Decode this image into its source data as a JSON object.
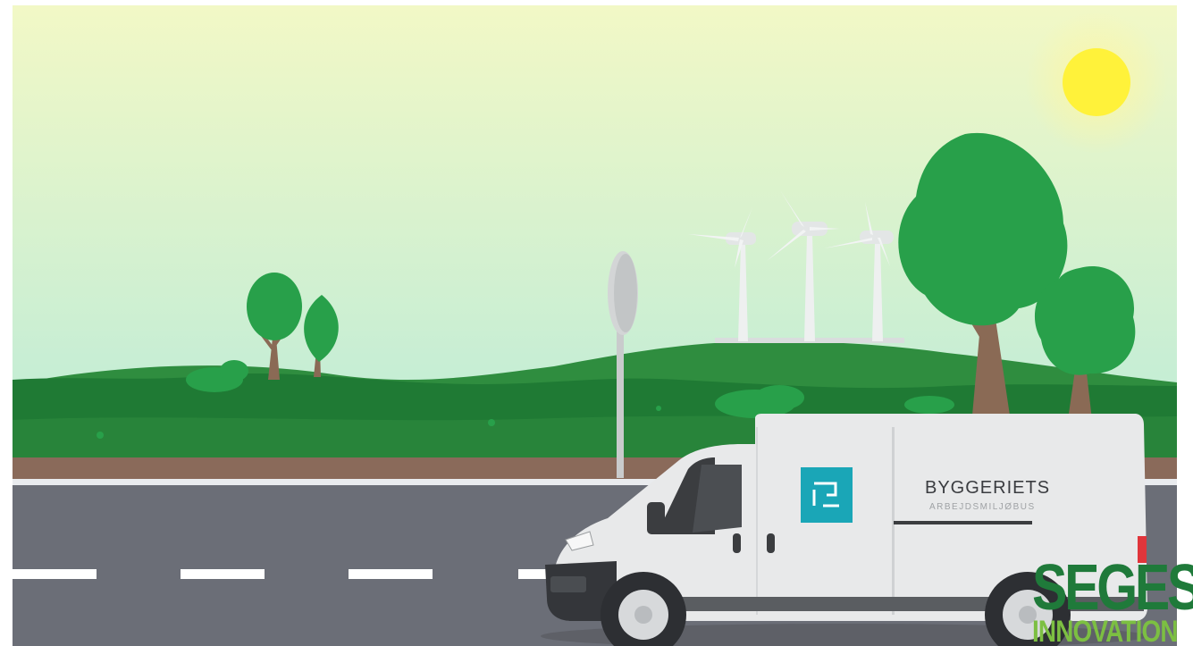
{
  "scene": {
    "colors": {
      "sky_top": "#f2f8c6",
      "sky_bottom": "#a6e6df",
      "hill_dark": "#1f7a34",
      "hill_mid": "#2f8d3f",
      "tree_green": "#28a04a",
      "trunk": "#8a6a55",
      "dirt": "#8a6a5a",
      "road": "#6b6e77",
      "road_line": "#ffffff",
      "van_body": "#e8e9ea",
      "van_dark": "#3b3d40",
      "logo_teal": "#1aa6b7",
      "sun": "#fff23a"
    },
    "icons": [
      "sun-icon",
      "wind-turbine-icon",
      "road-sign-icon",
      "van-icon",
      "van-logo-icon"
    ]
  },
  "van": {
    "brand_name": "BYGGERIETS",
    "brand_tagline": "ARBEJDSMILJØBUS"
  },
  "watermark": {
    "line1": "SEGES",
    "line2": "INNOVATION"
  }
}
